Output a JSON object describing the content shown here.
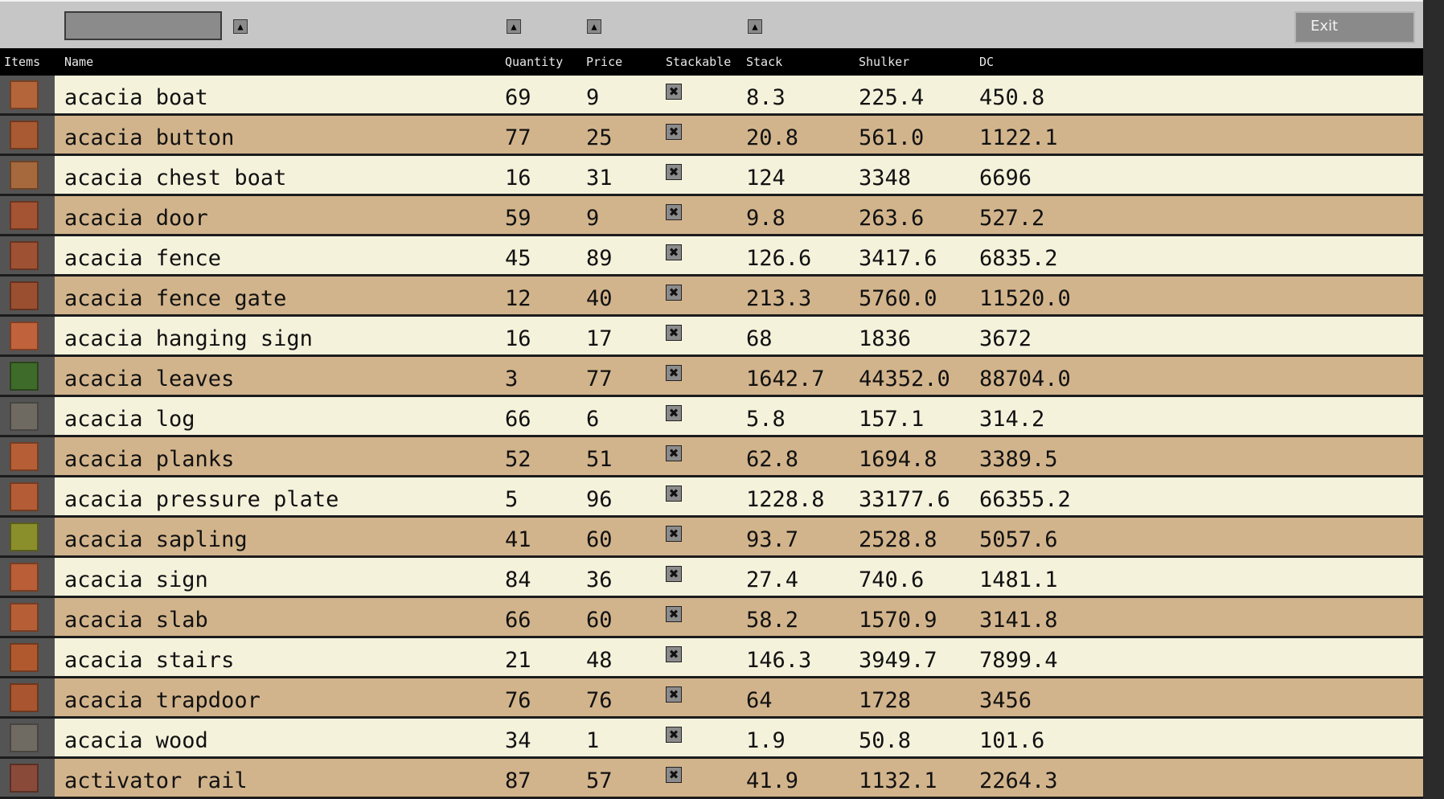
{
  "toolbar": {
    "search_value": "",
    "sort_glyph": "▲",
    "exit_label": "Exit"
  },
  "columns": [
    "Items",
    "Name",
    "Quantity",
    "Price",
    "Stackable",
    "Stack",
    "Shulker",
    "DC"
  ],
  "stackable_glyph": "✖",
  "rows": [
    {
      "name": "acacia boat",
      "qty": "69",
      "price": "9",
      "stack": "8.3",
      "shulker": "225.4",
      "dc": "450.8",
      "icon": "boat-icon",
      "color": "#b5653a"
    },
    {
      "name": "acacia button",
      "qty": "77",
      "price": "25",
      "stack": "20.8",
      "shulker": "561.0",
      "dc": "1122.1",
      "icon": "button-icon",
      "color": "#a95a33"
    },
    {
      "name": "acacia chest boat",
      "qty": "16",
      "price": "31",
      "stack": "124",
      "shulker": "3348",
      "dc": "6696",
      "icon": "chest-boat-icon",
      "color": "#a6693d"
    },
    {
      "name": "acacia door",
      "qty": "59",
      "price": "9",
      "stack": "9.8",
      "shulker": "263.6",
      "dc": "527.2",
      "icon": "door-icon",
      "color": "#a45433"
    },
    {
      "name": "acacia fence",
      "qty": "45",
      "price": "89",
      "stack": "126.6",
      "shulker": "3417.6",
      "dc": "6835.2",
      "icon": "fence-icon",
      "color": "#9e5233"
    },
    {
      "name": "acacia fence gate",
      "qty": "12",
      "price": "40",
      "stack": "213.3",
      "shulker": "5760.0",
      "dc": "11520.0",
      "icon": "fence-gate-icon",
      "color": "#9a4f31"
    },
    {
      "name": "acacia hanging sign",
      "qty": "16",
      "price": "17",
      "stack": "68",
      "shulker": "1836",
      "dc": "3672",
      "icon": "hanging-sign-icon",
      "color": "#c0633c"
    },
    {
      "name": "acacia leaves",
      "qty": "3",
      "price": "77",
      "stack": "1642.7",
      "shulker": "44352.0",
      "dc": "88704.0",
      "icon": "leaves-icon",
      "color": "#3f6b2a"
    },
    {
      "name": "acacia log",
      "qty": "66",
      "price": "6",
      "stack": "5.8",
      "shulker": "157.1",
      "dc": "314.2",
      "icon": "log-icon",
      "color": "#6e6a62"
    },
    {
      "name": "acacia planks",
      "qty": "52",
      "price": "51",
      "stack": "62.8",
      "shulker": "1694.8",
      "dc": "3389.5",
      "icon": "planks-icon",
      "color": "#b65f36"
    },
    {
      "name": "acacia pressure plate",
      "qty": "5",
      "price": "96",
      "stack": "1228.8",
      "shulker": "33177.6",
      "dc": "66355.2",
      "icon": "pressure-plate-icon",
      "color": "#b35c35"
    },
    {
      "name": "acacia sapling",
      "qty": "41",
      "price": "60",
      "stack": "93.7",
      "shulker": "2528.8",
      "dc": "5057.6",
      "icon": "sapling-icon",
      "color": "#8a8f2c"
    },
    {
      "name": "acacia sign",
      "qty": "84",
      "price": "36",
      "stack": "27.4",
      "shulker": "740.6",
      "dc": "1481.1",
      "icon": "sign-icon",
      "color": "#b95e37"
    },
    {
      "name": "acacia slab",
      "qty": "66",
      "price": "60",
      "stack": "58.2",
      "shulker": "1570.9",
      "dc": "3141.8",
      "icon": "slab-icon",
      "color": "#b65f36"
    },
    {
      "name": "acacia stairs",
      "qty": "21",
      "price": "48",
      "stack": "146.3",
      "shulker": "3949.7",
      "dc": "7899.4",
      "icon": "stairs-icon",
      "color": "#b0592f"
    },
    {
      "name": "acacia trapdoor",
      "qty": "76",
      "price": "76",
      "stack": "64",
      "shulker": "1728",
      "dc": "3456",
      "icon": "trapdoor-icon",
      "color": "#a9552f"
    },
    {
      "name": "acacia wood",
      "qty": "34",
      "price": "1",
      "stack": "1.9",
      "shulker": "50.8",
      "dc": "101.6",
      "icon": "wood-icon",
      "color": "#6f6b63"
    },
    {
      "name": "activator rail",
      "qty": "87",
      "price": "57",
      "stack": "41.9",
      "shulker": "1132.1",
      "dc": "2264.3",
      "icon": "activator-rail-icon",
      "color": "#8a4a3a"
    }
  ]
}
